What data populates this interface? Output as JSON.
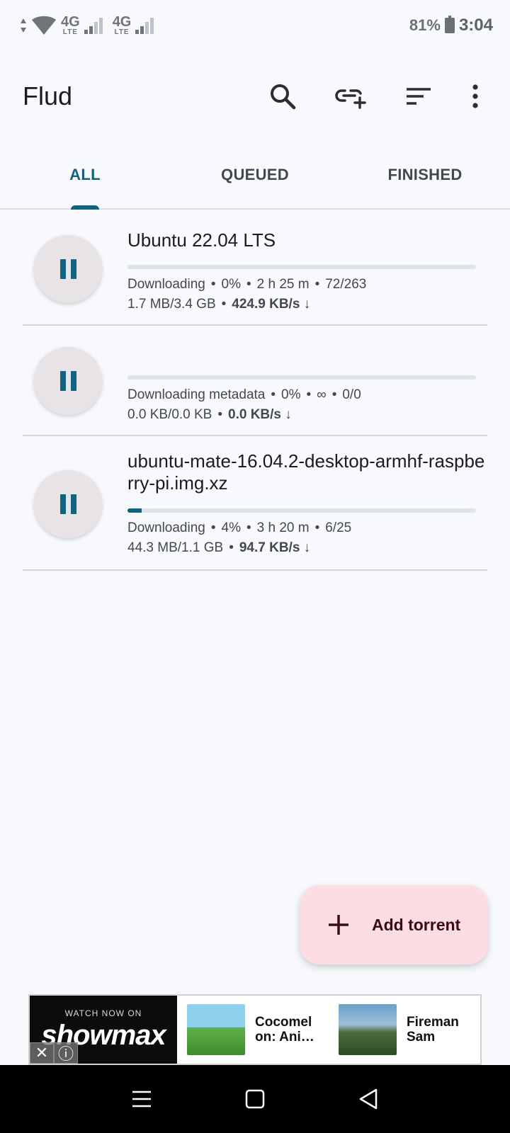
{
  "status_bar": {
    "network1": "4G",
    "network1_sub": "LTE",
    "network2": "4G",
    "network2_sub": "LTE",
    "battery": "81%",
    "time": "3:04"
  },
  "app_bar": {
    "title": "Flud",
    "icons": [
      "search-icon",
      "add-link-icon",
      "sort-icon",
      "more-vert-icon"
    ]
  },
  "tabs": [
    {
      "label": "ALL",
      "active": true
    },
    {
      "label": "QUEUED",
      "active": false
    },
    {
      "label": "FINISHED",
      "active": false
    }
  ],
  "torrents": [
    {
      "title": "Ubuntu 22.04 LTS",
      "status": "Downloading",
      "percent": "0%",
      "eta": "2 h 25 m",
      "pieces": "72/263",
      "size": "1.7 MB/3.4 GB",
      "speed": "424.9 KB/s ↓",
      "progress": 0
    },
    {
      "title": "",
      "status": "Downloading metadata",
      "percent": "0%",
      "eta": "∞",
      "pieces": "0/0",
      "size": "0.0 KB/0.0 KB",
      "speed": "0.0 KB/s ↓",
      "progress": 0
    },
    {
      "title": "ubuntu-mate-16.04.2-desktop-armhf-raspberry-pi.img.xz",
      "status": "Downloading",
      "percent": "4%",
      "eta": "3 h 20 m",
      "pieces": "6/25",
      "size": "44.3 MB/1.1 GB",
      "speed": "94.7 KB/s ↓",
      "progress": 0.04
    }
  ],
  "fab": {
    "label": "Add torrent"
  },
  "ad": {
    "small_text": "WATCH NOW ON",
    "brand": "showmax",
    "items": [
      {
        "label": "Cocomel on: Ani…"
      },
      {
        "label": "Fireman Sam"
      }
    ]
  },
  "colors": {
    "accent": "#11637f",
    "fab_bg": "#fbdde3",
    "background": "#f7f9fc"
  }
}
